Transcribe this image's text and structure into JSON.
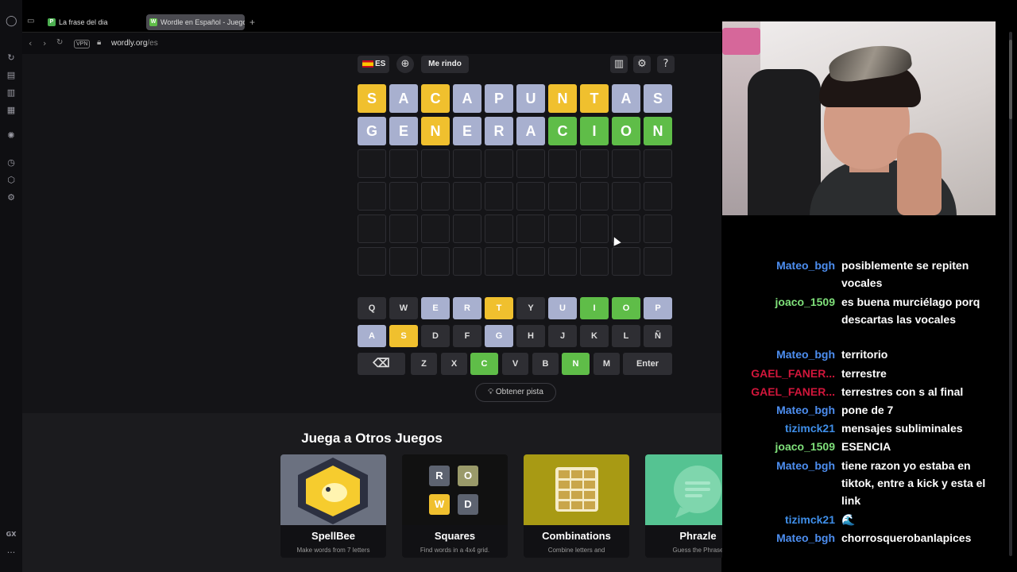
{
  "browser": {
    "tabs": [
      {
        "label": "La frase del dia",
        "favicon": "P",
        "active": false
      },
      {
        "label": "Wordle en Español - Juego",
        "favicon": "W",
        "active": true
      }
    ],
    "new_tab": "+",
    "vpn_label": "VPN",
    "url_domain": "wordly.org",
    "url_path": "/es",
    "sidebar_bottom_label": "GX",
    "sidebar_more": "..."
  },
  "game": {
    "language": "ES",
    "give_up_label": "Me rindo",
    "rows": [
      [
        {
          "l": "S",
          "s": "yellow"
        },
        {
          "l": "A",
          "s": "gray"
        },
        {
          "l": "C",
          "s": "yellow"
        },
        {
          "l": "A",
          "s": "gray"
        },
        {
          "l": "P",
          "s": "gray"
        },
        {
          "l": "U",
          "s": "gray"
        },
        {
          "l": "N",
          "s": "yellow"
        },
        {
          "l": "T",
          "s": "yellow"
        },
        {
          "l": "A",
          "s": "gray"
        },
        {
          "l": "S",
          "s": "gray"
        }
      ],
      [
        {
          "l": "G",
          "s": "gray"
        },
        {
          "l": "E",
          "s": "gray"
        },
        {
          "l": "N",
          "s": "yellow"
        },
        {
          "l": "E",
          "s": "gray"
        },
        {
          "l": "R",
          "s": "gray"
        },
        {
          "l": "A",
          "s": "gray"
        },
        {
          "l": "C",
          "s": "green"
        },
        {
          "l": "I",
          "s": "green"
        },
        {
          "l": "O",
          "s": "green"
        },
        {
          "l": "N",
          "s": "green"
        }
      ],
      [],
      [],
      [],
      []
    ],
    "keyboard": [
      [
        {
          "k": "Q",
          "s": "none"
        },
        {
          "k": "W",
          "s": "none"
        },
        {
          "k": "E",
          "s": "gray"
        },
        {
          "k": "R",
          "s": "gray"
        },
        {
          "k": "T",
          "s": "yellow"
        },
        {
          "k": "Y",
          "s": "none"
        },
        {
          "k": "U",
          "s": "gray"
        },
        {
          "k": "I",
          "s": "green"
        },
        {
          "k": "O",
          "s": "green"
        },
        {
          "k": "P",
          "s": "gray"
        }
      ],
      [
        {
          "k": "A",
          "s": "gray"
        },
        {
          "k": "S",
          "s": "yellow"
        },
        {
          "k": "D",
          "s": "none"
        },
        {
          "k": "F",
          "s": "none"
        },
        {
          "k": "G",
          "s": "gray"
        },
        {
          "k": "H",
          "s": "none"
        },
        {
          "k": "J",
          "s": "none"
        },
        {
          "k": "K",
          "s": "none"
        },
        {
          "k": "L",
          "s": "none"
        },
        {
          "k": "Ñ",
          "s": "none"
        }
      ],
      [
        {
          "k": "⌫",
          "s": "none"
        },
        {
          "k": "Z",
          "s": "none"
        },
        {
          "k": "X",
          "s": "none"
        },
        {
          "k": "C",
          "s": "green"
        },
        {
          "k": "V",
          "s": "none"
        },
        {
          "k": "B",
          "s": "none"
        },
        {
          "k": "N",
          "s": "green"
        },
        {
          "k": "M",
          "s": "none"
        },
        {
          "k": "Enter",
          "s": "none"
        }
      ]
    ],
    "hint_label": "Obtener pista"
  },
  "other_games": {
    "title": "Juega a Otros Juegos",
    "cards": [
      {
        "name": "SpellBee",
        "desc": "Make words from 7 letters"
      },
      {
        "name": "Squares",
        "desc": "Find words in a 4x4 grid."
      },
      {
        "name": "Combinations",
        "desc": "Combine letters and"
      },
      {
        "name": "Phrazle",
        "desc": "Guess the Phrase"
      }
    ],
    "squares_letters": [
      "R",
      "O",
      "W",
      "D"
    ]
  },
  "chat": [
    {
      "user": "Mateo_bgh",
      "color": "#4d8ef0",
      "text": "posiblemente se repiten vocales"
    },
    {
      "user": "joaco_1509",
      "color": "#7fe07a",
      "text": "es buena murciélago porq descartas las vocales"
    },
    {
      "user": "Mateo_bgh",
      "color": "#4d8ef0",
      "text": "territorio"
    },
    {
      "user": "GAEL_FANER...",
      "color": "#d1163b",
      "text": "terrestre"
    },
    {
      "user": "GAEL_FANER...",
      "color": "#d1163b",
      "text": "terrestres con s al final"
    },
    {
      "user": "Mateo_bgh",
      "color": "#4d8ef0",
      "text": "pone de 7"
    },
    {
      "user": "tizimck21",
      "color": "#3f8ee8",
      "text": "mensajes subliminales"
    },
    {
      "user": "joaco_1509",
      "color": "#7fe07a",
      "text": "ESENCIA"
    },
    {
      "user": "Mateo_bgh",
      "color": "#4d8ef0",
      "text": "tiene razon yo estaba en tiktok, entre a kick y esta el link"
    },
    {
      "user": "tizimck21",
      "color": "#3f8ee8",
      "text": "🌊"
    },
    {
      "user": "Mateo_bgh",
      "color": "#4d8ef0",
      "text": "chorrosquerobanlapices"
    }
  ]
}
